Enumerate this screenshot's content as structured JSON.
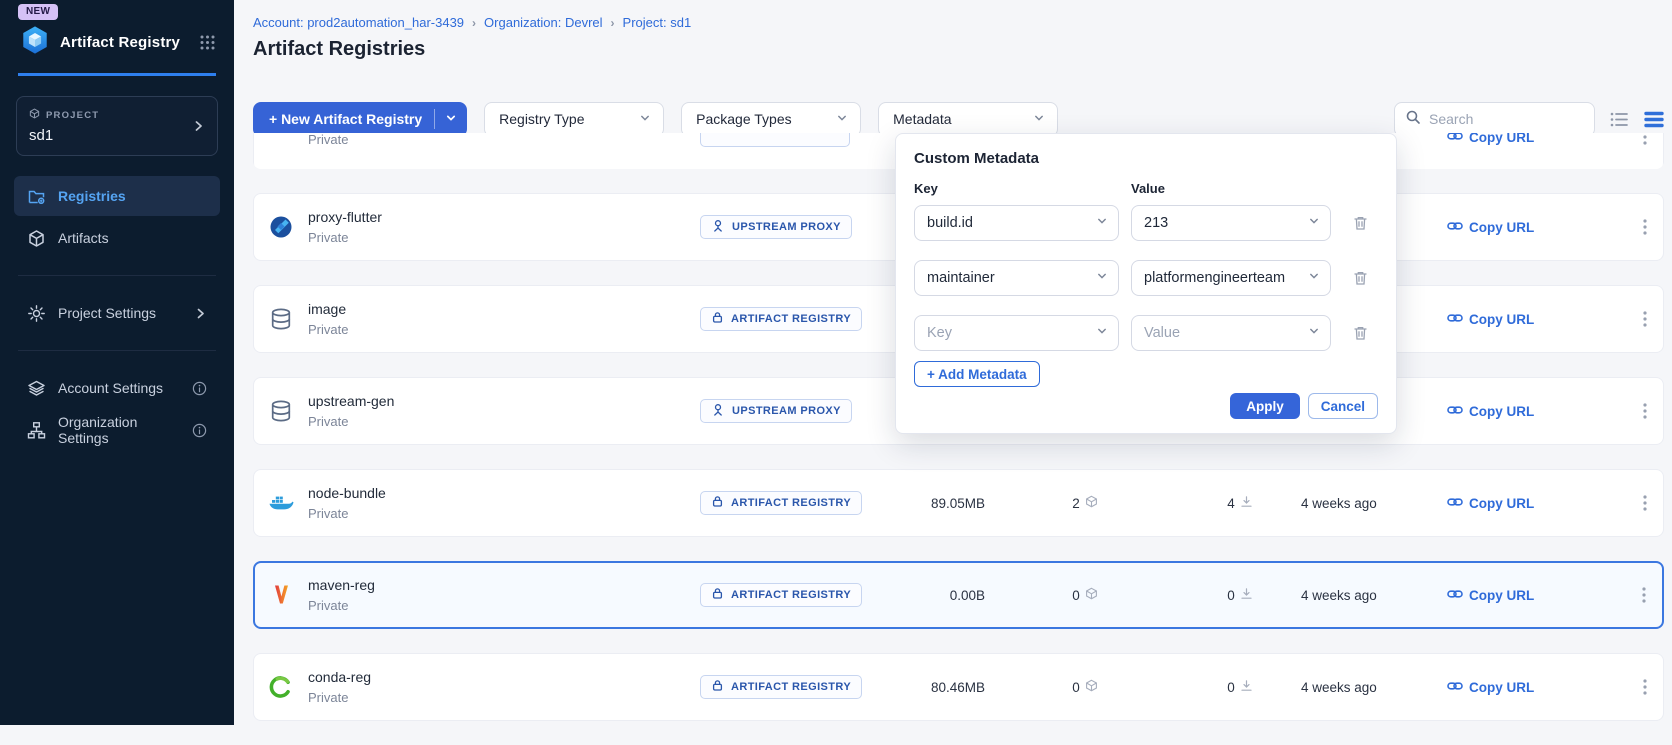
{
  "colors": {
    "sidebar_bg": "#0c1c2e",
    "accent_blue": "#3663d6",
    "link_blue": "#2f6bd9",
    "badge_blue": "#2a56ab",
    "selected_row_border": "#3b77e0",
    "active_nav_text": "#55a4f2"
  },
  "sidebar": {
    "new_badge": "NEW",
    "app_title": "Artifact Registry",
    "project_label": "PROJECT",
    "project_name": "sd1",
    "nav": [
      {
        "label": "Registries",
        "icon": "registries",
        "active": true
      },
      {
        "label": "Artifacts",
        "icon": "artifacts",
        "active": false
      }
    ],
    "secondary_nav": [
      {
        "label": "Project Settings",
        "icon": "gear",
        "chevron": true,
        "info": false
      },
      {
        "label": "Account Settings",
        "icon": "layers",
        "chevron": false,
        "info": true
      },
      {
        "label": "Organization Settings",
        "icon": "org",
        "chevron": false,
        "info": true
      }
    ]
  },
  "header": {
    "breadcrumb": [
      "Account: prod2automation_har-3439",
      "Organization: Devrel",
      "Project: sd1"
    ],
    "title": "Artifact Registries"
  },
  "toolbar": {
    "new_button_label": "+ New Artifact Registry",
    "filters": [
      "Registry Type",
      "Package Types",
      "Metadata"
    ],
    "search_placeholder": "Search"
  },
  "popover": {
    "title": "Custom Metadata",
    "key_label": "Key",
    "value_label": "Value",
    "rows": [
      {
        "key": "build.id",
        "value": "213",
        "is_placeholder": false
      },
      {
        "key": "maintainer",
        "value": "platformengineerteam",
        "is_placeholder": false
      },
      {
        "key": "Key",
        "value": "Value",
        "is_placeholder": true
      }
    ],
    "add_button_label": "+ Add Metadata",
    "apply_label": "Apply",
    "cancel_label": "Cancel"
  },
  "table": {
    "rows": [
      {
        "partial": true,
        "name": "",
        "visibility": "Private",
        "badge": "",
        "icon": "",
        "size": "",
        "artifacts": "",
        "downloads": "",
        "updated": "",
        "copy_label": "Copy URL",
        "selected": false
      },
      {
        "partial": false,
        "name": "proxy-flutter",
        "visibility": "Private",
        "badge": "UPSTREAM PROXY",
        "icon": "flutter",
        "size": "",
        "artifacts": "",
        "downloads": "",
        "updated": "",
        "copy_label": "Copy URL",
        "selected": false
      },
      {
        "partial": false,
        "name": "image",
        "visibility": "Private",
        "badge": "ARTIFACT REGISTRY",
        "icon": "database",
        "size": "",
        "artifacts": "",
        "downloads": "",
        "updated": "",
        "copy_label": "Copy URL",
        "selected": false
      },
      {
        "partial": false,
        "name": "upstream-gen",
        "visibility": "Private",
        "badge": "UPSTREAM PROXY",
        "icon": "database",
        "size": "",
        "artifacts": "",
        "downloads": "",
        "updated": "",
        "copy_label": "Copy URL",
        "selected": false
      },
      {
        "partial": false,
        "name": "node-bundle",
        "visibility": "Private",
        "badge": "ARTIFACT REGISTRY",
        "icon": "docker",
        "size": "89.05MB",
        "artifacts": "2",
        "downloads": "4",
        "updated": "4 weeks ago",
        "copy_label": "Copy URL",
        "selected": false
      },
      {
        "partial": false,
        "name": "maven-reg",
        "visibility": "Private",
        "badge": "ARTIFACT REGISTRY",
        "icon": "maven",
        "size": "0.00B",
        "artifacts": "0",
        "downloads": "0",
        "updated": "4 weeks ago",
        "copy_label": "Copy URL",
        "selected": true
      },
      {
        "partial": false,
        "name": "conda-reg",
        "visibility": "Private",
        "badge": "ARTIFACT REGISTRY",
        "icon": "conda",
        "size": "80.46MB",
        "artifacts": "0",
        "downloads": "0",
        "updated": "4 weeks ago",
        "copy_label": "Copy URL",
        "selected": false
      }
    ]
  }
}
